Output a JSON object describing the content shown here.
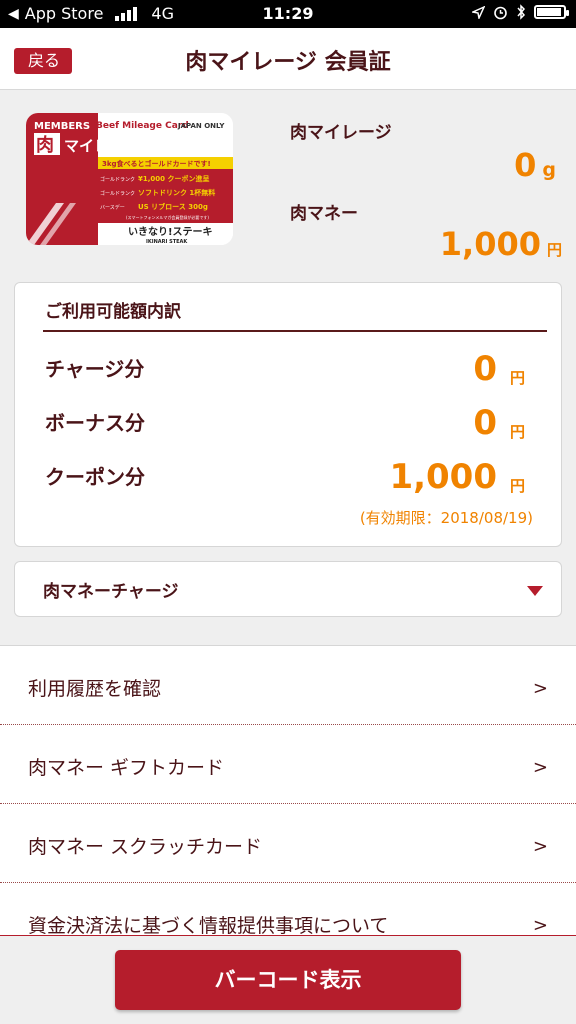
{
  "status_bar": {
    "back_app": "App Store",
    "network": "4G",
    "time": "11:29"
  },
  "nav": {
    "back_label": "戻る",
    "title": "肉マイレージ 会員証"
  },
  "card": {
    "members": "MEMBERS",
    "beef_mileage": "Beef Mileage Card",
    "japan_only": "JAPAN ONLY",
    "kanji": "肉",
    "card_name": "マイレージカード",
    "gold_text": "3kg食べるとゴールドカードです!",
    "rank_left": "ゴールドランク",
    "coupon": "¥1,000 クーポン進呈",
    "drink_left": "ゴールドランク",
    "drink": "ソフトドリンク 1杯無料",
    "present_left": "バースデー",
    "present": "US リブロース 300g",
    "note": "(スマートフォンメルマガ会員登録が必要です)",
    "brand": "いきなり!ステーキ",
    "brand_en": "IKINARI STEAK"
  },
  "summary": {
    "mileage_label": "肉マイレージ",
    "mileage_value": "0",
    "mileage_unit": "g",
    "money_label": "肉マネー",
    "money_value": "1,000",
    "money_unit": "円"
  },
  "breakdown": {
    "title": "ご利用可能額内訳",
    "rows": [
      {
        "label": "チャージ分",
        "value": "0",
        "unit": "円"
      },
      {
        "label": "ボーナス分",
        "value": "0",
        "unit": "円"
      },
      {
        "label": "クーポン分",
        "value": "1,000",
        "unit": "円"
      }
    ],
    "expiry": "(有効期限：2018/08/19)"
  },
  "charge": {
    "label": "肉マネーチャージ"
  },
  "menu": [
    {
      "label": "利用履歴を確認",
      "chevron": ">"
    },
    {
      "label": "肉マネー ギフトカード",
      "chevron": ">"
    },
    {
      "label": "肉マネー スクラッチカード",
      "chevron": ">"
    },
    {
      "label": "資金決済法に基づく情報提供事項について",
      "chevron": ">"
    }
  ],
  "footer": {
    "barcode_label": "バーコード表示"
  },
  "colors": {
    "brand_red": "#b51d2c",
    "value_orange": "#f08300",
    "text_dark": "#4a1418"
  }
}
